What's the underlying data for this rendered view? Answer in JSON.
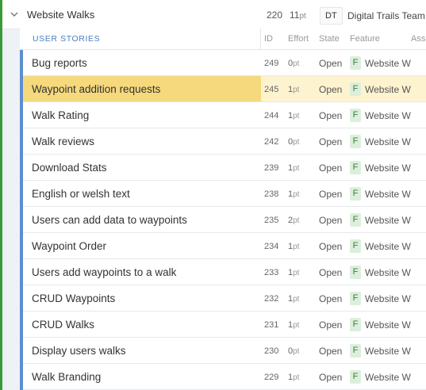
{
  "colors": {
    "feature_strip": "#3a9a3a",
    "story_accent": "#5b8fcf",
    "selected_title_bg": "#f6d97c",
    "selected_row_bg": "#fdf3cf",
    "feature_badge_bg": "#dcefdc"
  },
  "feature": {
    "icon": "chevron-down-icon",
    "title": "Website Walks",
    "id": "220",
    "points_value": "11",
    "points_unit": "pt",
    "team_badge": "DT",
    "team_name": "Digital Trails Team"
  },
  "columns": {
    "stories": "USER STORIES",
    "id": "ID",
    "effort": "Effort",
    "state": "State",
    "feature": "Feature",
    "assignee": "Ass"
  },
  "stories": [
    {
      "title": "Bug reports",
      "id": "249",
      "effort": "0",
      "unit": "pt",
      "state": "Open",
      "badge": "F",
      "feature": "Website W",
      "selected": false
    },
    {
      "title": "Waypoint addition requests",
      "id": "245",
      "effort": "1",
      "unit": "pt",
      "state": "Open",
      "badge": "F",
      "feature": "Website W",
      "selected": true
    },
    {
      "title": "Walk Rating",
      "id": "244",
      "effort": "1",
      "unit": "pt",
      "state": "Open",
      "badge": "F",
      "feature": "Website W",
      "selected": false
    },
    {
      "title": "Walk reviews",
      "id": "242",
      "effort": "0",
      "unit": "pt",
      "state": "Open",
      "badge": "F",
      "feature": "Website W",
      "selected": false
    },
    {
      "title": "Download Stats",
      "id": "239",
      "effort": "1",
      "unit": "pt",
      "state": "Open",
      "badge": "F",
      "feature": "Website W",
      "selected": false
    },
    {
      "title": "English or welsh text",
      "id": "238",
      "effort": "1",
      "unit": "pt",
      "state": "Open",
      "badge": "F",
      "feature": "Website W",
      "selected": false
    },
    {
      "title": "Users can add data to waypoints",
      "id": "235",
      "effort": "2",
      "unit": "pt",
      "state": "Open",
      "badge": "F",
      "feature": "Website W",
      "selected": false
    },
    {
      "title": "Waypoint Order",
      "id": "234",
      "effort": "1",
      "unit": "pt",
      "state": "Open",
      "badge": "F",
      "feature": "Website W",
      "selected": false
    },
    {
      "title": "Users add waypoints to a walk",
      "id": "233",
      "effort": "1",
      "unit": "pt",
      "state": "Open",
      "badge": "F",
      "feature": "Website W",
      "selected": false
    },
    {
      "title": "CRUD Waypoints",
      "id": "232",
      "effort": "1",
      "unit": "pt",
      "state": "Open",
      "badge": "F",
      "feature": "Website W",
      "selected": false
    },
    {
      "title": "CRUD Walks",
      "id": "231",
      "effort": "1",
      "unit": "pt",
      "state": "Open",
      "badge": "F",
      "feature": "Website W",
      "selected": false
    },
    {
      "title": "Display users walks",
      "id": "230",
      "effort": "0",
      "unit": "pt",
      "state": "Open",
      "badge": "F",
      "feature": "Website W",
      "selected": false
    },
    {
      "title": "Walk Branding",
      "id": "229",
      "effort": "1",
      "unit": "pt",
      "state": "Open",
      "badge": "F",
      "feature": "Website W",
      "selected": false
    }
  ]
}
